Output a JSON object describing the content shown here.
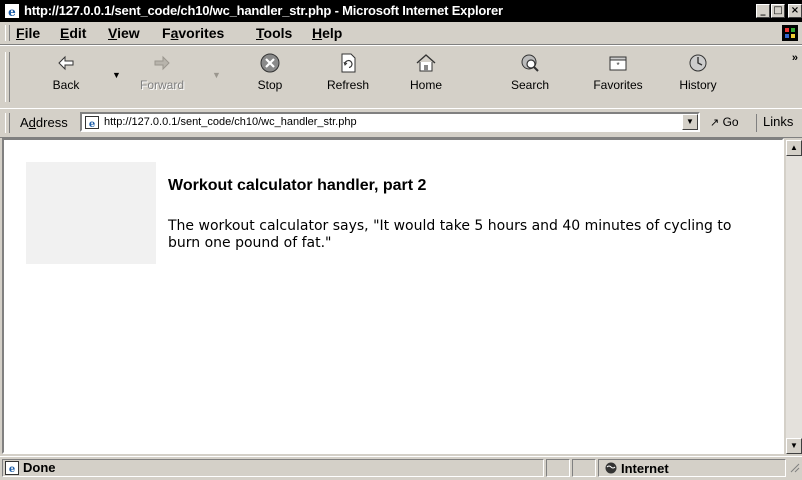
{
  "window": {
    "title": "http://127.0.0.1/sent_code/ch10/wc_handler_str.php - Microsoft Internet Explorer",
    "controls": {
      "minimize": "_",
      "maximize": "□",
      "close": "×"
    }
  },
  "menu": {
    "items": [
      {
        "pre": "",
        "key": "F",
        "post": "ile"
      },
      {
        "pre": "",
        "key": "E",
        "post": "dit"
      },
      {
        "pre": "",
        "key": "V",
        "post": "iew"
      },
      {
        "pre": "F",
        "key": "a",
        "post": "vorites"
      },
      {
        "pre": "",
        "key": "T",
        "post": "ools"
      },
      {
        "pre": "",
        "key": "H",
        "post": "elp"
      }
    ]
  },
  "toolbar": {
    "back": "Back",
    "forward": "Forward",
    "stop": "Stop",
    "refresh": "Refresh",
    "home": "Home",
    "search": "Search",
    "favorites": "Favorites",
    "history": "History",
    "more": "»"
  },
  "address": {
    "label_key": "d",
    "label_pre": "A",
    "label_post": "dress",
    "url": "http://127.0.0.1/sent_code/ch10/wc_handler_str.php",
    "go": "Go",
    "links": "Links"
  },
  "page": {
    "title": "Workout calculator handler, part 2",
    "message": "The workout calculator says, \"It would take 5 hours and 40 minutes of cycling to burn one pound of fat.\""
  },
  "status": {
    "text": "Done",
    "zone": "Internet"
  },
  "colors": {
    "chrome": "#d4d0c8",
    "titlebar": "#000000",
    "placeholder": "#f1f1f1"
  }
}
